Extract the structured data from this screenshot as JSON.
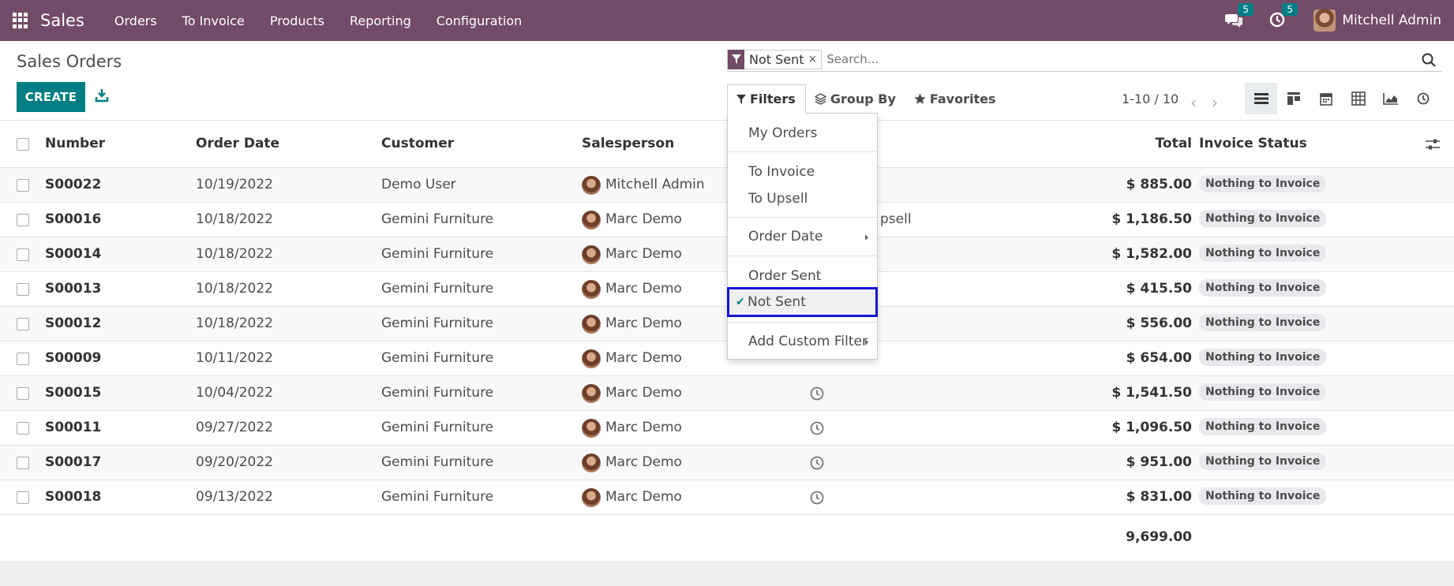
{
  "navbar": {
    "app_name": "Sales",
    "menus": [
      "Orders",
      "To Invoice",
      "Products",
      "Reporting",
      "Configuration"
    ],
    "messages_count": "5",
    "activities_count": "5",
    "user_name": "Mitchell Admin"
  },
  "control": {
    "page_title": "Sales Orders",
    "create_label": "CREATE",
    "search": {
      "facet_value": "Not Sent",
      "facet_remove": "×",
      "placeholder": "Search..."
    },
    "filters_label": "Filters",
    "groupby_label": "Group By",
    "favorites_label": "Favorites",
    "pager": "1-10 / 10"
  },
  "filter_menu": {
    "my_orders": "My Orders",
    "to_invoice": "To Invoice",
    "to_upsell": "To Upsell",
    "order_date": "Order Date",
    "order_sent": "Order Sent",
    "not_sent": "Not Sent",
    "add_custom": "Add Custom Filter",
    "check": "✔"
  },
  "table": {
    "headers": {
      "number": "Number",
      "order_date": "Order Date",
      "customer": "Customer",
      "salesperson": "Salesperson",
      "total": "Total",
      "invoice_status": "Invoice Status"
    },
    "rows": [
      {
        "number": "S00022",
        "date": "10/19/2022",
        "customer": "Demo User",
        "salesperson": "Mitchell Admin",
        "activity": "",
        "total": "$ 885.00",
        "status": "Nothing to Invoice"
      },
      {
        "number": "S00016",
        "date": "10/18/2022",
        "customer": "Gemini Furniture",
        "salesperson": "Marc Demo",
        "activity": "psell",
        "total": "$ 1,186.50",
        "status": "Nothing to Invoice"
      },
      {
        "number": "S00014",
        "date": "10/18/2022",
        "customer": "Gemini Furniture",
        "salesperson": "Marc Demo",
        "activity": "",
        "total": "$ 1,582.00",
        "status": "Nothing to Invoice"
      },
      {
        "number": "S00013",
        "date": "10/18/2022",
        "customer": "Gemini Furniture",
        "salesperson": "Marc Demo",
        "activity": "",
        "total": "$ 415.50",
        "status": "Nothing to Invoice"
      },
      {
        "number": "S00012",
        "date": "10/18/2022",
        "customer": "Gemini Furniture",
        "salesperson": "Marc Demo",
        "activity": "",
        "total": "$ 556.00",
        "status": "Nothing to Invoice"
      },
      {
        "number": "S00009",
        "date": "10/11/2022",
        "customer": "Gemini Furniture",
        "salesperson": "Marc Demo",
        "activity": "",
        "total": "$ 654.00",
        "status": "Nothing to Invoice"
      },
      {
        "number": "S00015",
        "date": "10/04/2022",
        "customer": "Gemini Furniture",
        "salesperson": "Marc Demo",
        "activity": "clock",
        "total": "$ 1,541.50",
        "status": "Nothing to Invoice"
      },
      {
        "number": "S00011",
        "date": "09/27/2022",
        "customer": "Gemini Furniture",
        "salesperson": "Marc Demo",
        "activity": "clock",
        "total": "$ 1,096.50",
        "status": "Nothing to Invoice"
      },
      {
        "number": "S00017",
        "date": "09/20/2022",
        "customer": "Gemini Furniture",
        "salesperson": "Marc Demo",
        "activity": "clock",
        "total": "$ 951.00",
        "status": "Nothing to Invoice"
      },
      {
        "number": "S00018",
        "date": "09/13/2022",
        "customer": "Gemini Furniture",
        "salesperson": "Marc Demo",
        "activity": "clock",
        "total": "$ 831.00",
        "status": "Nothing to Invoice"
      }
    ],
    "footer_total": "9,699.00"
  },
  "colors": {
    "navbar": "#714b67",
    "primary": "#017e84",
    "highlight_border": "#1616d6"
  }
}
